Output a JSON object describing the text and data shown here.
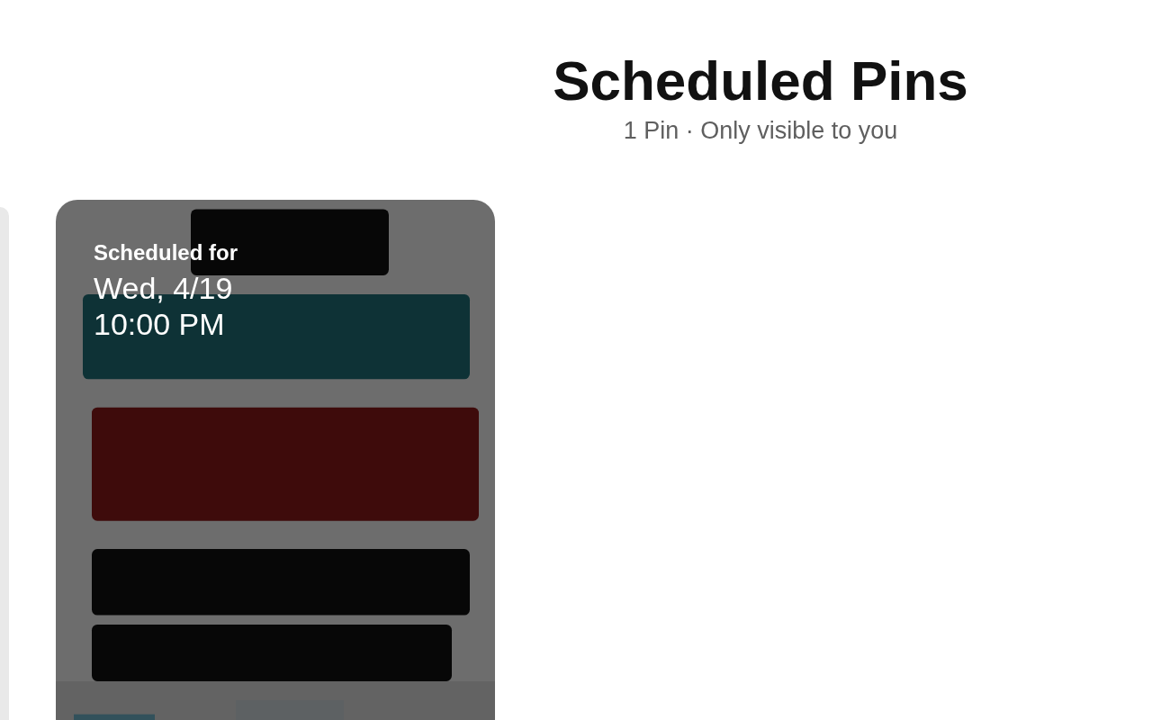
{
  "header": {
    "title": "Scheduled Pins",
    "subtitle": "1 Pin · Only visible to you"
  },
  "pins": [
    {
      "kind": "picture",
      "label": "Scheduled for",
      "date": "Wed, 4/19",
      "time": "10:00 PM"
    }
  ]
}
